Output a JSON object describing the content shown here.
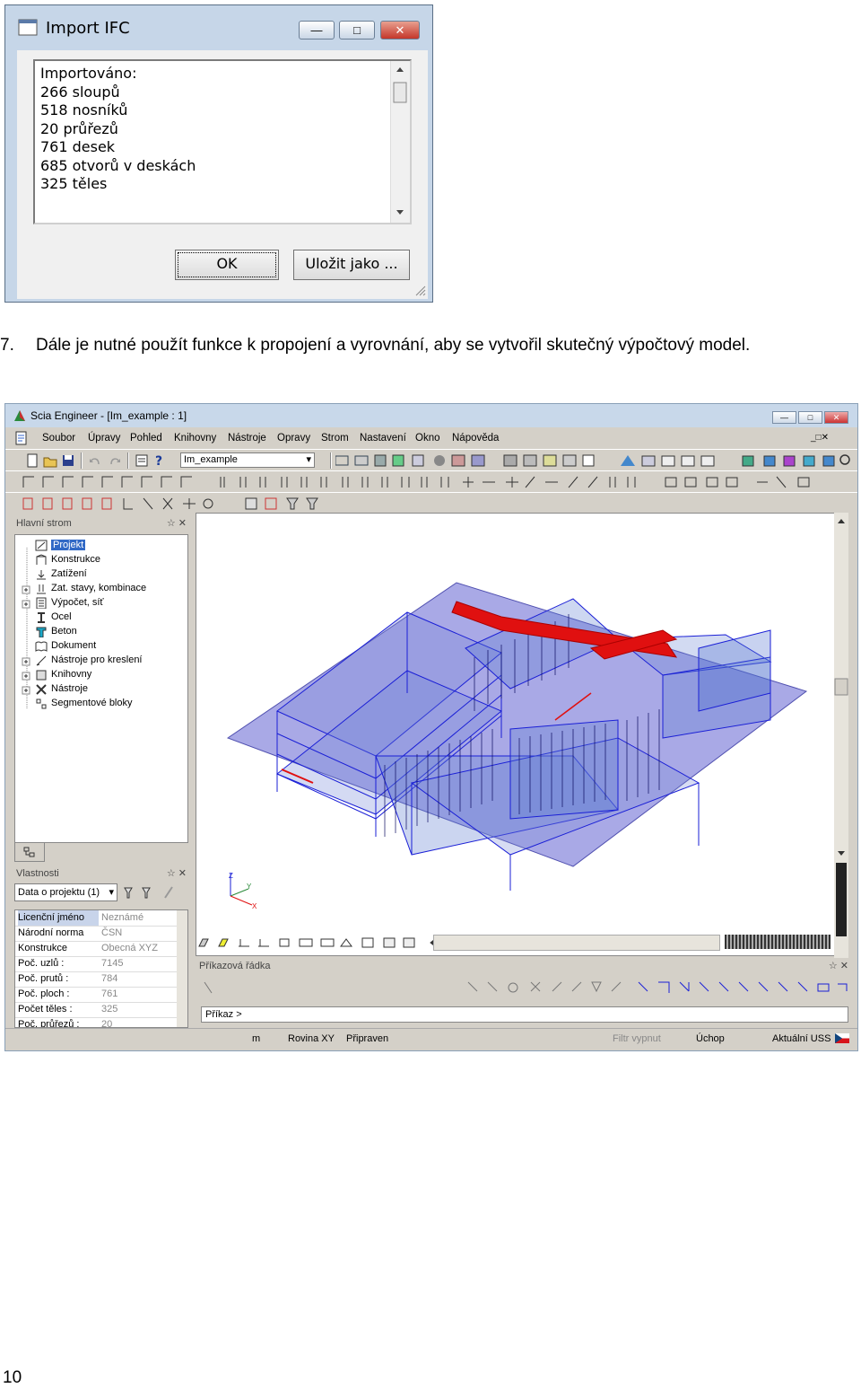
{
  "dialog": {
    "title": "Import IFC",
    "lines": [
      "Importováno:",
      "266 sloupů",
      "518 nosníků",
      "20 průřezů",
      "761 desek",
      "685 otvorů v deskách",
      "325 těles"
    ],
    "ok_label": "OK",
    "save_label": "Uložit jako ..."
  },
  "step": {
    "number": "7.",
    "text": "Dále je nutné použít funkce k propojení a vyrovnání, aby se vytvořil skutečný výpočtový model."
  },
  "app": {
    "title": "Scia Engineer - [Im_example : 1]",
    "menu": [
      "Soubor",
      "Úpravy",
      "Pohled",
      "Knihovny",
      "Nástroje",
      "Opravy",
      "Strom",
      "Nastavení",
      "Okno",
      "Nápověda"
    ],
    "project_combo": "Im_example",
    "tree_title": "Hlavní strom",
    "tree_items": [
      "Projekt",
      "Konstrukce",
      "Zatížení",
      "Zat. stavy, kombinace",
      "Výpočet, síť",
      "Ocel",
      "Beton",
      "Dokument",
      "Nástroje pro kreslení",
      "Knihovny",
      "Nástroje",
      "Segmentové bloky"
    ],
    "props_title": "Vlastnosti",
    "props_combo": "Data o projektu (1)",
    "props": [
      {
        "k": "Licenční jméno",
        "v": "Neznámé"
      },
      {
        "k": "Národní norma",
        "v": "ČSN"
      },
      {
        "k": "Konstrukce",
        "v": "Obecná XYZ"
      },
      {
        "k": "Poč. uzlů :",
        "v": "7145"
      },
      {
        "k": "Poč. prutů :",
        "v": "784"
      },
      {
        "k": "Poč. ploch :",
        "v": "761"
      },
      {
        "k": "Počet těles :",
        "v": "325"
      },
      {
        "k": "Poč. průřezů :",
        "v": "20"
      }
    ],
    "cmd_title": "Příkazová řádka",
    "cmd_prompt": "Příkaz >",
    "status": {
      "unit": "m",
      "plane": "Rovina XY",
      "state": "Připraven",
      "filter": "Filtr vypnut",
      "snap": "Úchop",
      "uss": "Aktuální USS"
    }
  },
  "page_number": "10",
  "colors": {
    "selection": "#3169c6",
    "model_blue": "#1a1fd6",
    "slab": "#7d7dd8",
    "roof_red": "#e01010"
  }
}
